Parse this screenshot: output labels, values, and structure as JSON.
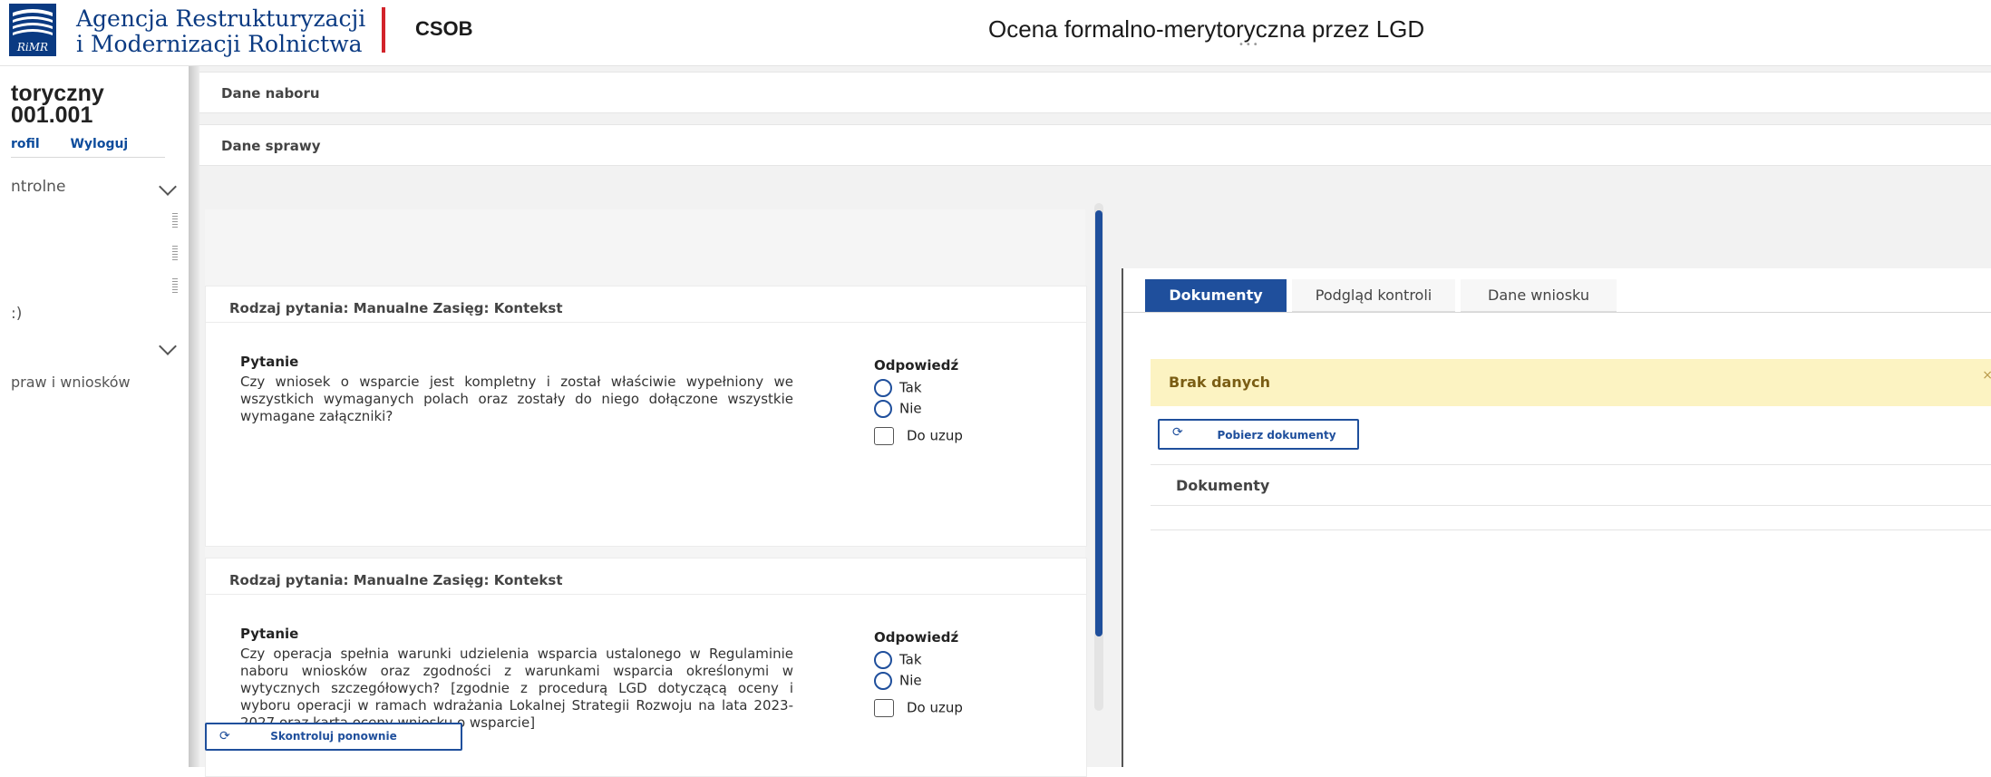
{
  "header": {
    "agency_line_1": "Agencja Restrukturyzacji",
    "agency_line_2": "i Modernizacji Rolnictwa",
    "logo_text": "RiMR",
    "system_name": "CSOB",
    "page_title": "Ocena formalno-merytoryczna przez LGD",
    "brand_red": "#d2232a",
    "brand_blue": "#0a3a82"
  },
  "sidebar": {
    "title_line_1": "toryczny",
    "title_line_2": "001.001",
    "profile_link": "rofil",
    "logout_link": "Wyloguj",
    "menu_controls": "ntrolne",
    "menu_partial": ":)",
    "menu_cases": "praw i wniosków"
  },
  "sections": {
    "nabor": "Dane naboru",
    "sprawa": "Dane sprawy"
  },
  "questions": [
    {
      "header": "Rodzaj pytania: Manualne Zasięg: Kontekst",
      "label": "Pytanie",
      "text": "Czy wniosek o wsparcie jest kompletny i został właściwie wypełniony we wszystkich wymaganych polach oraz zostały do niego dołączone wszystkie wymagane załączniki?",
      "answer_label": "Odpowiedź",
      "option_yes": "Tak",
      "option_no": "Nie",
      "checkbox_label": "Do uzup"
    },
    {
      "header": "Rodzaj pytania: Manualne Zasięg: Kontekst",
      "label": "Pytanie",
      "text": "Czy operacja spełnia warunki udzielenia wsparcia ustalonego w Regulaminie naboru wniosków oraz zgodności z warunkami wsparcia określonymi w wytycznych szczegółowych? [zgodnie z procedurą LGD dotyczącą oceny i wyboru operacji w ramach wdrażania Lokalnej Strategii Rozwoju na lata 2023-2027 oraz kartą oceny wniosku o wsparcie]",
      "answer_label": "Odpowiedź",
      "option_yes": "Tak",
      "option_no": "Nie",
      "checkbox_label": "Do uzup"
    }
  ],
  "recheck_button": "Skontroluj ponownie",
  "right_panel": {
    "tabs": [
      "Dokumenty",
      "Podgląd kontroli",
      "Dane wniosku"
    ],
    "active_tab": "Dokumenty",
    "alert_text": "Brak danych",
    "alert_close": "×",
    "fetch_button": "Pobierz dokumenty",
    "docs_header": "Dokumenty"
  },
  "icons": {
    "refresh": "refresh-icon",
    "chevron": "chevron-down-icon"
  },
  "colors": {
    "accent": "#1f4f9c",
    "alert_bg": "#fcf3c2",
    "alert_text": "#7a5d14"
  }
}
